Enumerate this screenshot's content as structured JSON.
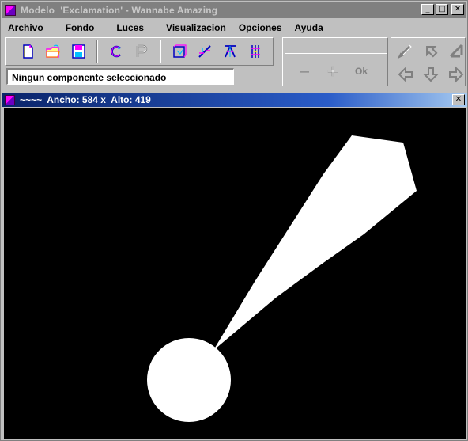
{
  "window": {
    "title": "Modelo  'Exclamation' - Wannabe Amazing",
    "minimize_label": "_",
    "maximize_label": "□",
    "close_label": "✕"
  },
  "menu": [
    "Archivo",
    "Fondo",
    "Luces",
    "Visualizacion",
    "Opciones",
    "Ayuda"
  ],
  "toolbar": {
    "groups": [
      [
        "new-file-icon",
        "open-folder-icon",
        "save-disk-icon"
      ],
      [
        "rotate-c-icon",
        "p-icon"
      ],
      [
        "box-icon",
        "measure-icon",
        "split-icon",
        "grid-icon"
      ]
    ],
    "accent_colors": [
      "#ff00ff",
      "#00c0ff",
      "#ffff00",
      "#0000ff"
    ]
  },
  "status": {
    "text": "Ningun componente seleccionado"
  },
  "name_field": {
    "value": ""
  },
  "edit_buttons": {
    "minus_label": "—",
    "plus_label": "+",
    "ok_label": "Ok"
  },
  "arrow_buttons": [
    "up-left-arrow-icon",
    "up-arrow-icon",
    "up-right-arrow-icon",
    "left-arrow-icon",
    "down-arrow-icon",
    "right-arrow-icon"
  ],
  "child_window": {
    "title": "~~~~  Ancho: 584 x  Alto: 419",
    "close_label": "✕"
  },
  "canvas": {
    "background": "#000000",
    "shape_color": "#ffffff"
  }
}
